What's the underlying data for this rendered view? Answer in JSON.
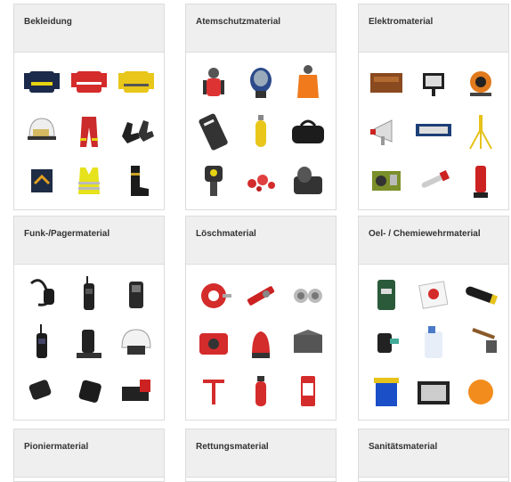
{
  "categories": [
    {
      "title": "Bekleidung",
      "items": [
        "firefighter-jacket-icon",
        "red-sweater-icon",
        "yellow-jacket-icon",
        "helmet-icon",
        "red-trousers-icon",
        "gloves-icon",
        "rank-patch-icon",
        "safety-vest-icon",
        "boots-icon"
      ]
    },
    {
      "title": "Atemschutzmaterial",
      "items": [
        "breathing-apparatus-icon",
        "full-face-mask-icon",
        "orange-suit-icon",
        "harness-board-icon",
        "gas-cylinder-icon",
        "black-bag-icon",
        "thermal-camera-icon",
        "red-parts-icon",
        "mask-case-icon"
      ]
    },
    {
      "title": "Elektromaterial",
      "items": [
        "generator-box-icon",
        "floodlight-icon",
        "cable-reel-icon",
        "megaphone-icon",
        "light-bar-icon",
        "tripod-icon",
        "power-generator-icon",
        "test-probe-icon",
        "flashlight-icon"
      ]
    },
    {
      "title": "Funk-/Pagermaterial",
      "items": [
        "radio-microphone-icon",
        "handheld-radio-icon",
        "pager-icon",
        "radio-handset-icon",
        "charger-stand-icon",
        "radio-headset-helmet-icon",
        "pager-clip-icon",
        "black-holster-icon",
        "charging-cradle-icon"
      ]
    },
    {
      "title": "Löschmaterial",
      "items": [
        "fire-hose-icon",
        "hose-nozzle-icon",
        "hose-coupling-icon",
        "water-pump-icon",
        "red-water-buoy-icon",
        "grey-tarp-icon",
        "hydrant-key-icon",
        "fire-extinguisher-icon",
        "red-warning-sign-icon"
      ]
    },
    {
      "title": "Oel- / Chemiewehrmaterial",
      "items": [
        "absorbent-sack-icon",
        "absorbent-pad-icon",
        "absorbent-boom-icon",
        "chemical-pump-icon",
        "chemical-canister-icon",
        "scraper-shovel-icon",
        "blue-container-icon",
        "test-kit-case-icon",
        "sealing-ball-icon"
      ]
    },
    {
      "title": "Pioniermaterial",
      "items": []
    },
    {
      "title": "Rettungsmaterial",
      "items": []
    },
    {
      "title": "Sanitätsmaterial",
      "items": []
    }
  ]
}
